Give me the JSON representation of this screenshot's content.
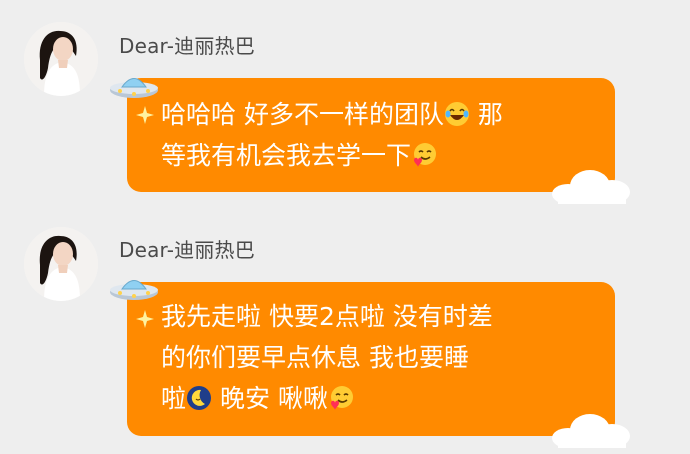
{
  "messages": [
    {
      "sender": "Dear-迪丽热巴",
      "lines": [
        {
          "before": "哈哈哈 好多不一样的团队",
          "emoji": "laughing-tears-emoji",
          "after": " 那"
        },
        {
          "before": "等我有机会我去学一下",
          "emoji": "savoring-tongue-heart-emoji",
          "after": ""
        }
      ]
    },
    {
      "sender": "Dear-迪丽热巴",
      "lines": [
        {
          "before": "我先走啦 快要2点啦 没有时差",
          "emoji": "",
          "after": ""
        },
        {
          "before": "的你们要早点休息 我也要睡",
          "emoji": "",
          "after": ""
        },
        {
          "before": "啦",
          "emoji": "moon-sleep-emoji",
          "after": " 晚安 啾啾",
          "emoji2": "savoring-tongue-heart-emoji"
        }
      ]
    }
  ],
  "colors": {
    "background": "#eeeeee",
    "bubble": "#ff8a00",
    "bubble_text": "#ffffff",
    "sender_text": "#4a4a4a"
  },
  "icons": [
    "avatar",
    "ufo-icon",
    "sparkle-icon",
    "cloud-icon"
  ]
}
